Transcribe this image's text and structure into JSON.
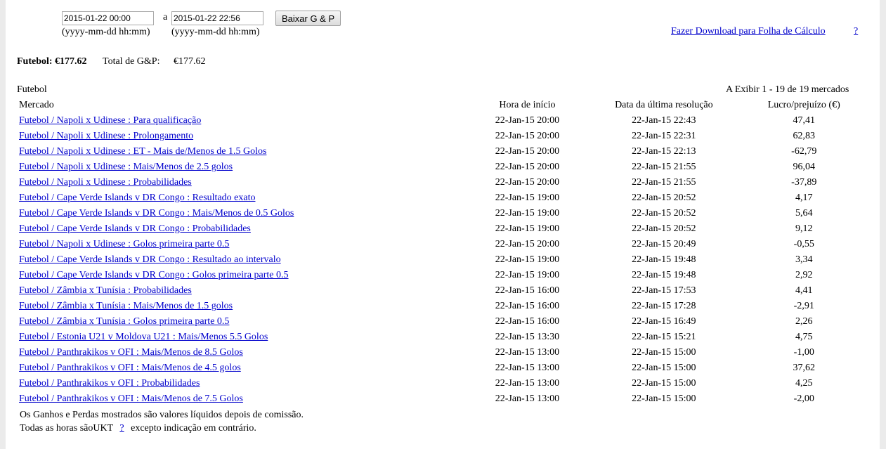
{
  "filter": {
    "from_value": "2015-01-22 00:00",
    "separator": "a",
    "to_value": "2015-01-22 22:56",
    "button_label": "Baixar G & P",
    "from_hint": "(yyyy-mm-dd hh:mm)",
    "to_hint": "(yyyy-mm-dd hh:mm)"
  },
  "download": {
    "link_label": "Fazer Download para Folha de Cálculo",
    "help_label": "?"
  },
  "summary": {
    "sport_label": "Futebol: €177.62",
    "total_label": "Total de G&P:",
    "total_value": "€177.62"
  },
  "section": {
    "title": "Futebol",
    "showing": "A Exibir 1 - 19 de 19 mercados"
  },
  "table": {
    "headers": [
      "Mercado",
      "Hora de início",
      "Data da última resolução",
      "Lucro/prejuízo (€)"
    ],
    "rows": [
      {
        "market": "Futebol / Napoli x Udinese : Para qualificação",
        "start": "22-Jan-15 20:00",
        "settled": "22-Jan-15 22:43",
        "pl": "47,41"
      },
      {
        "market": "Futebol / Napoli x Udinese : Prolongamento",
        "start": "22-Jan-15 20:00",
        "settled": "22-Jan-15 22:31",
        "pl": "62,83"
      },
      {
        "market": "Futebol / Napoli x Udinese : ET - Mais de/Menos de 1.5 Golos",
        "start": "22-Jan-15 20:00",
        "settled": "22-Jan-15 22:13",
        "pl": "-62,79"
      },
      {
        "market": "Futebol / Napoli x Udinese : Mais/Menos de 2.5 golos",
        "start": "22-Jan-15 20:00",
        "settled": "22-Jan-15 21:55",
        "pl": "96,04"
      },
      {
        "market": "Futebol / Napoli x Udinese : Probabilidades",
        "start": "22-Jan-15 20:00",
        "settled": "22-Jan-15 21:55",
        "pl": "-37,89"
      },
      {
        "market": "Futebol / Cape Verde Islands v DR Congo : Resultado exato",
        "start": "22-Jan-15 19:00",
        "settled": "22-Jan-15 20:52",
        "pl": "4,17"
      },
      {
        "market": "Futebol / Cape Verde Islands v DR Congo : Mais/Menos de 0.5 Golos",
        "start": "22-Jan-15 19:00",
        "settled": "22-Jan-15 20:52",
        "pl": "5,64"
      },
      {
        "market": "Futebol / Cape Verde Islands v DR Congo : Probabilidades",
        "start": "22-Jan-15 19:00",
        "settled": "22-Jan-15 20:52",
        "pl": "9,12"
      },
      {
        "market": "Futebol / Napoli x Udinese : Golos primeira parte 0.5",
        "start": "22-Jan-15 20:00",
        "settled": "22-Jan-15 20:49",
        "pl": "-0,55"
      },
      {
        "market": "Futebol / Cape Verde Islands v DR Congo : Resultado ao intervalo",
        "start": "22-Jan-15 19:00",
        "settled": "22-Jan-15 19:48",
        "pl": "3,34"
      },
      {
        "market": "Futebol / Cape Verde Islands v DR Congo : Golos primeira parte 0.5",
        "start": "22-Jan-15 19:00",
        "settled": "22-Jan-15 19:48",
        "pl": "2,92"
      },
      {
        "market": "Futebol / Zâmbia x Tunísia : Probabilidades",
        "start": "22-Jan-15 16:00",
        "settled": "22-Jan-15 17:53",
        "pl": "4,41"
      },
      {
        "market": "Futebol / Zâmbia x Tunísia : Mais/Menos de 1.5 golos",
        "start": "22-Jan-15 16:00",
        "settled": "22-Jan-15 17:28",
        "pl": "-2,91"
      },
      {
        "market": "Futebol / Zâmbia x Tunísia : Golos primeira parte 0.5",
        "start": "22-Jan-15 16:00",
        "settled": "22-Jan-15 16:49",
        "pl": "2,26"
      },
      {
        "market": "Futebol / Estonia U21 v Moldova U21 : Mais/Menos 5.5 Golos",
        "start": "22-Jan-15 13:30",
        "settled": "22-Jan-15 15:21",
        "pl": "4,75"
      },
      {
        "market": "Futebol / Panthrakikos v OFI : Mais/Menos de 8.5 Golos",
        "start": "22-Jan-15 13:00",
        "settled": "22-Jan-15 15:00",
        "pl": "-1,00"
      },
      {
        "market": "Futebol / Panthrakikos v OFI : Mais/Menos de 4.5 golos",
        "start": "22-Jan-15 13:00",
        "settled": "22-Jan-15 15:00",
        "pl": "37,62"
      },
      {
        "market": "Futebol / Panthrakikos v OFI : Probabilidades",
        "start": "22-Jan-15 13:00",
        "settled": "22-Jan-15 15:00",
        "pl": "4,25"
      },
      {
        "market": "Futebol / Panthrakikos v OFI : Mais/Menos de 7.5 Golos",
        "start": "22-Jan-15 13:00",
        "settled": "22-Jan-15 15:00",
        "pl": "-2,00"
      }
    ]
  },
  "footer": {
    "note": "Os Ganhos e Perdas mostrados são valores líquidos depois de comissão.",
    "tz_prefix": "Todas as horas sãoUKT",
    "tz_help": "?",
    "tz_suffix": "excepto indicação em contrário."
  }
}
